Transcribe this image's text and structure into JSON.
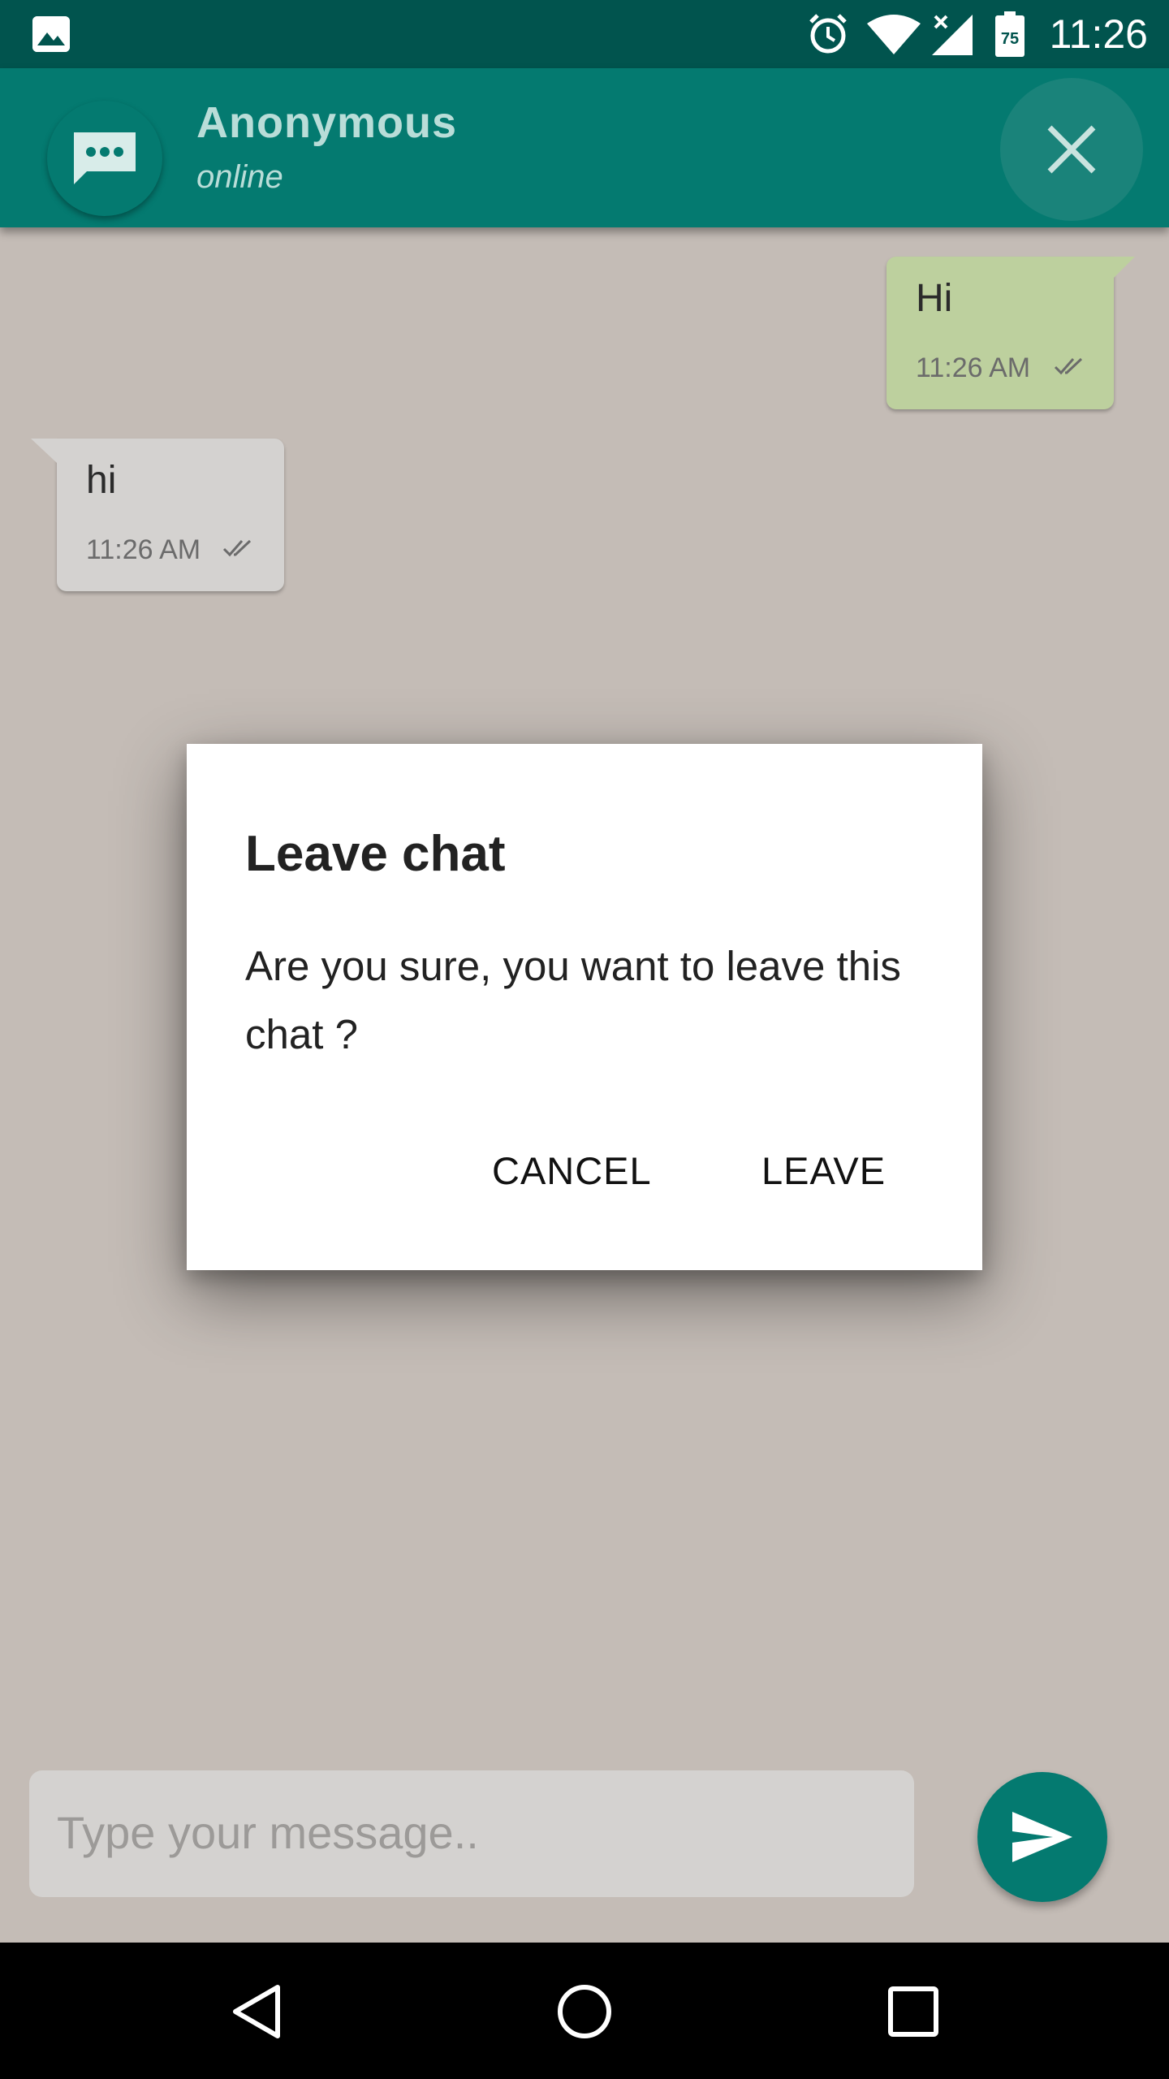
{
  "status_bar": {
    "time": "11:26",
    "battery_level": "75",
    "icons": [
      "gallery-icon",
      "alarm-icon",
      "wifi-icon",
      "signal-icon",
      "battery-icon"
    ]
  },
  "app_bar": {
    "title": "Anonymous",
    "subtitle": "online",
    "avatar_icon": "chat-bubble-icon",
    "close_icon": "close-icon"
  },
  "messages": [
    {
      "direction": "outgoing",
      "text": "Hi",
      "time": "11:26 AM",
      "status_icon": "double-check-icon"
    },
    {
      "direction": "incoming",
      "text": "hi",
      "time": "11:26 AM",
      "status_icon": "double-check-icon"
    }
  ],
  "dialog": {
    "title": "Leave chat",
    "message": "Are you sure, you want to leave this chat ?",
    "cancel_label": "CANCEL",
    "confirm_label": "LEAVE"
  },
  "composer": {
    "placeholder": "Type your message..",
    "send_icon": "send-icon"
  },
  "nav_bar": {
    "icons": [
      "back-icon",
      "home-icon",
      "recents-icon"
    ]
  },
  "colors": {
    "app_bar": "#047a70",
    "status_bar": "#01544e",
    "chat_background": "#c4bcb6",
    "outgoing_bubble": "#bdd09e",
    "incoming_bubble": "#d4d2d0"
  }
}
